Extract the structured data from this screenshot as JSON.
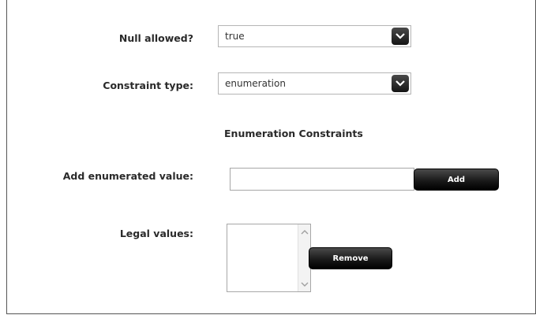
{
  "form": {
    "null_allowed": {
      "label": "Null allowed?",
      "value": "true"
    },
    "constraint_type": {
      "label": "Constraint type:",
      "value": "enumeration"
    },
    "section_title": "Enumeration Constraints",
    "add_value": {
      "label": "Add enumerated value:",
      "value": "",
      "button": "Add"
    },
    "legal_values": {
      "label": "Legal values:",
      "items": [],
      "button": "Remove"
    }
  },
  "icons": {
    "dropdown": "chevron-down-icon",
    "scroll_up": "scroll-up-arrow-icon",
    "scroll_down": "scroll-down-arrow-icon"
  }
}
